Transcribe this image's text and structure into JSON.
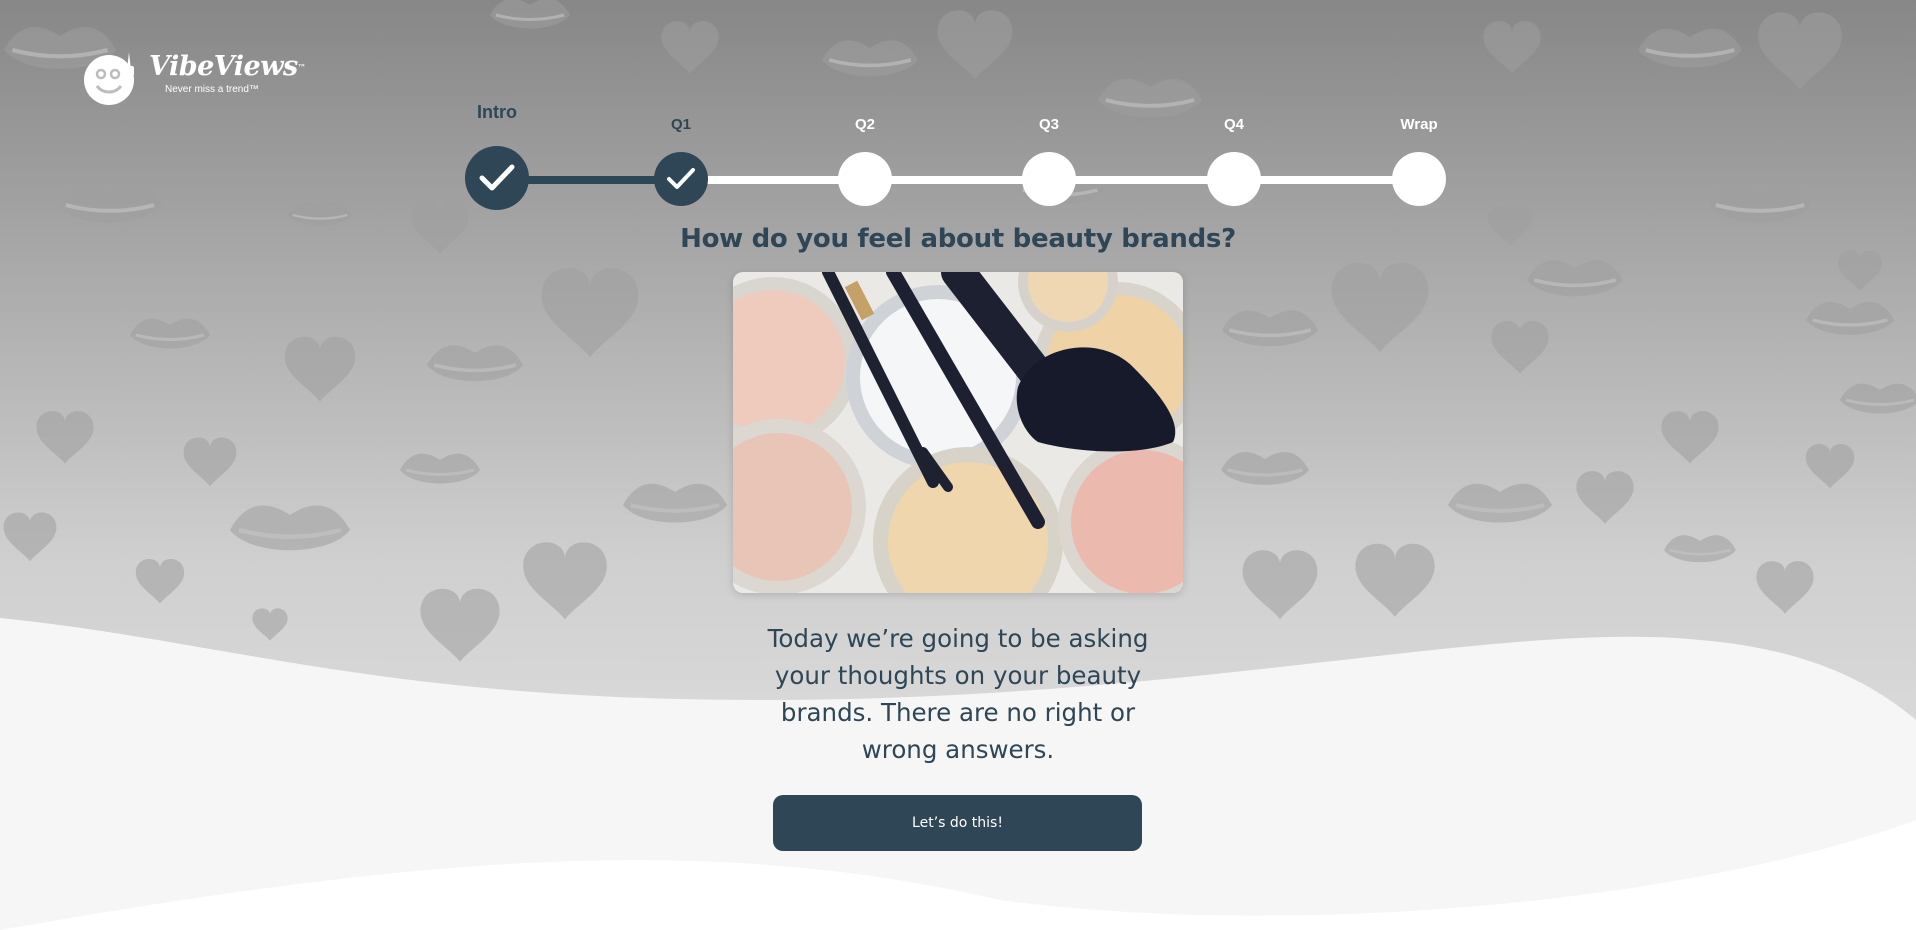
{
  "brand": {
    "name": "VibeViews",
    "trademark": "™",
    "tagline": "Never miss a trend™"
  },
  "progress": {
    "steps": [
      {
        "label": "Intro",
        "status": "done",
        "current": true
      },
      {
        "label": "Q1",
        "status": "done",
        "current": false
      },
      {
        "label": "Q2",
        "status": "todo",
        "current": false
      },
      {
        "label": "Q3",
        "status": "todo",
        "current": false
      },
      {
        "label": "Q4",
        "status": "todo",
        "current": false
      },
      {
        "label": "Wrap",
        "status": "todo",
        "current": false
      }
    ],
    "completed_fraction": 0.2
  },
  "main": {
    "question": "How do you feel about beauty brands?",
    "image_alt": "beauty-products-photo",
    "description": "Today we’re going to be asking your thoughts on your beauty brands. There are no right or wrong answers.",
    "cta_label": "Let’s do this!"
  },
  "colors": {
    "primary": "#2e4656",
    "step_todo": "#ffffff",
    "background_top": "#8a8a8a",
    "background_bottom": "#f6f6f6"
  }
}
